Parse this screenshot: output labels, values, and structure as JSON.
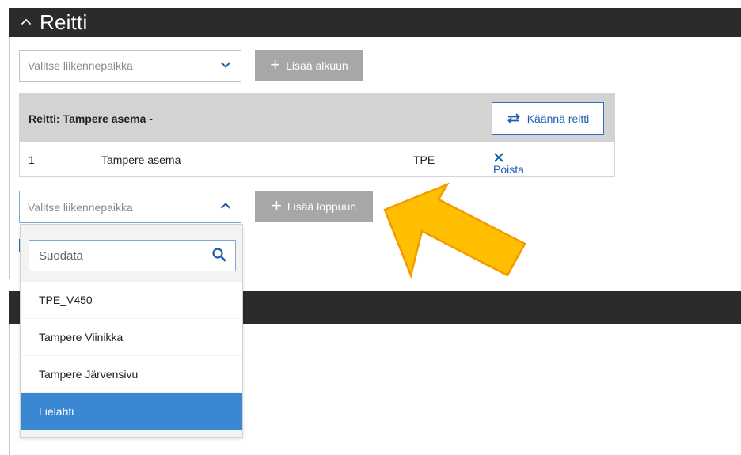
{
  "section": {
    "title": "Reitti",
    "collapse_icon": "chevron-up-icon"
  },
  "start_select": {
    "placeholder": "Valitse liikennepaikka",
    "icon": "chevron-down-icon"
  },
  "add_start_button": {
    "label": "Lisää alkuun",
    "icon": "plus-icon"
  },
  "route": {
    "title": "Reitti: Tampere asema -",
    "reverse_button": {
      "label": "Käännä reitti",
      "icon": "swap-arrows-icon"
    },
    "rows": [
      {
        "index": "1",
        "name": "Tampere asema",
        "code": "TPE",
        "remove_label": "Poista"
      }
    ]
  },
  "end_select": {
    "placeholder": "Valitse liikennepaikka",
    "icon": "chevron-up-icon"
  },
  "add_end_button": {
    "label": "Lisää loppuun",
    "icon": "plus-icon"
  },
  "dropdown": {
    "filter_placeholder": "Suodata",
    "options": [
      {
        "label": "TPE_V450",
        "selected": false
      },
      {
        "label": "Tampere Viinikka",
        "selected": false
      },
      {
        "label": "Tampere Järvensivu",
        "selected": false
      },
      {
        "label": "Lielahti",
        "selected": true
      }
    ]
  },
  "colors": {
    "header_bg": "#2b2b2b",
    "accent_blue": "#2a70c8",
    "selected_option": "#3a87d2",
    "disabled_button": "#a7a7a7",
    "annotation_arrow": "#ffbe00"
  }
}
